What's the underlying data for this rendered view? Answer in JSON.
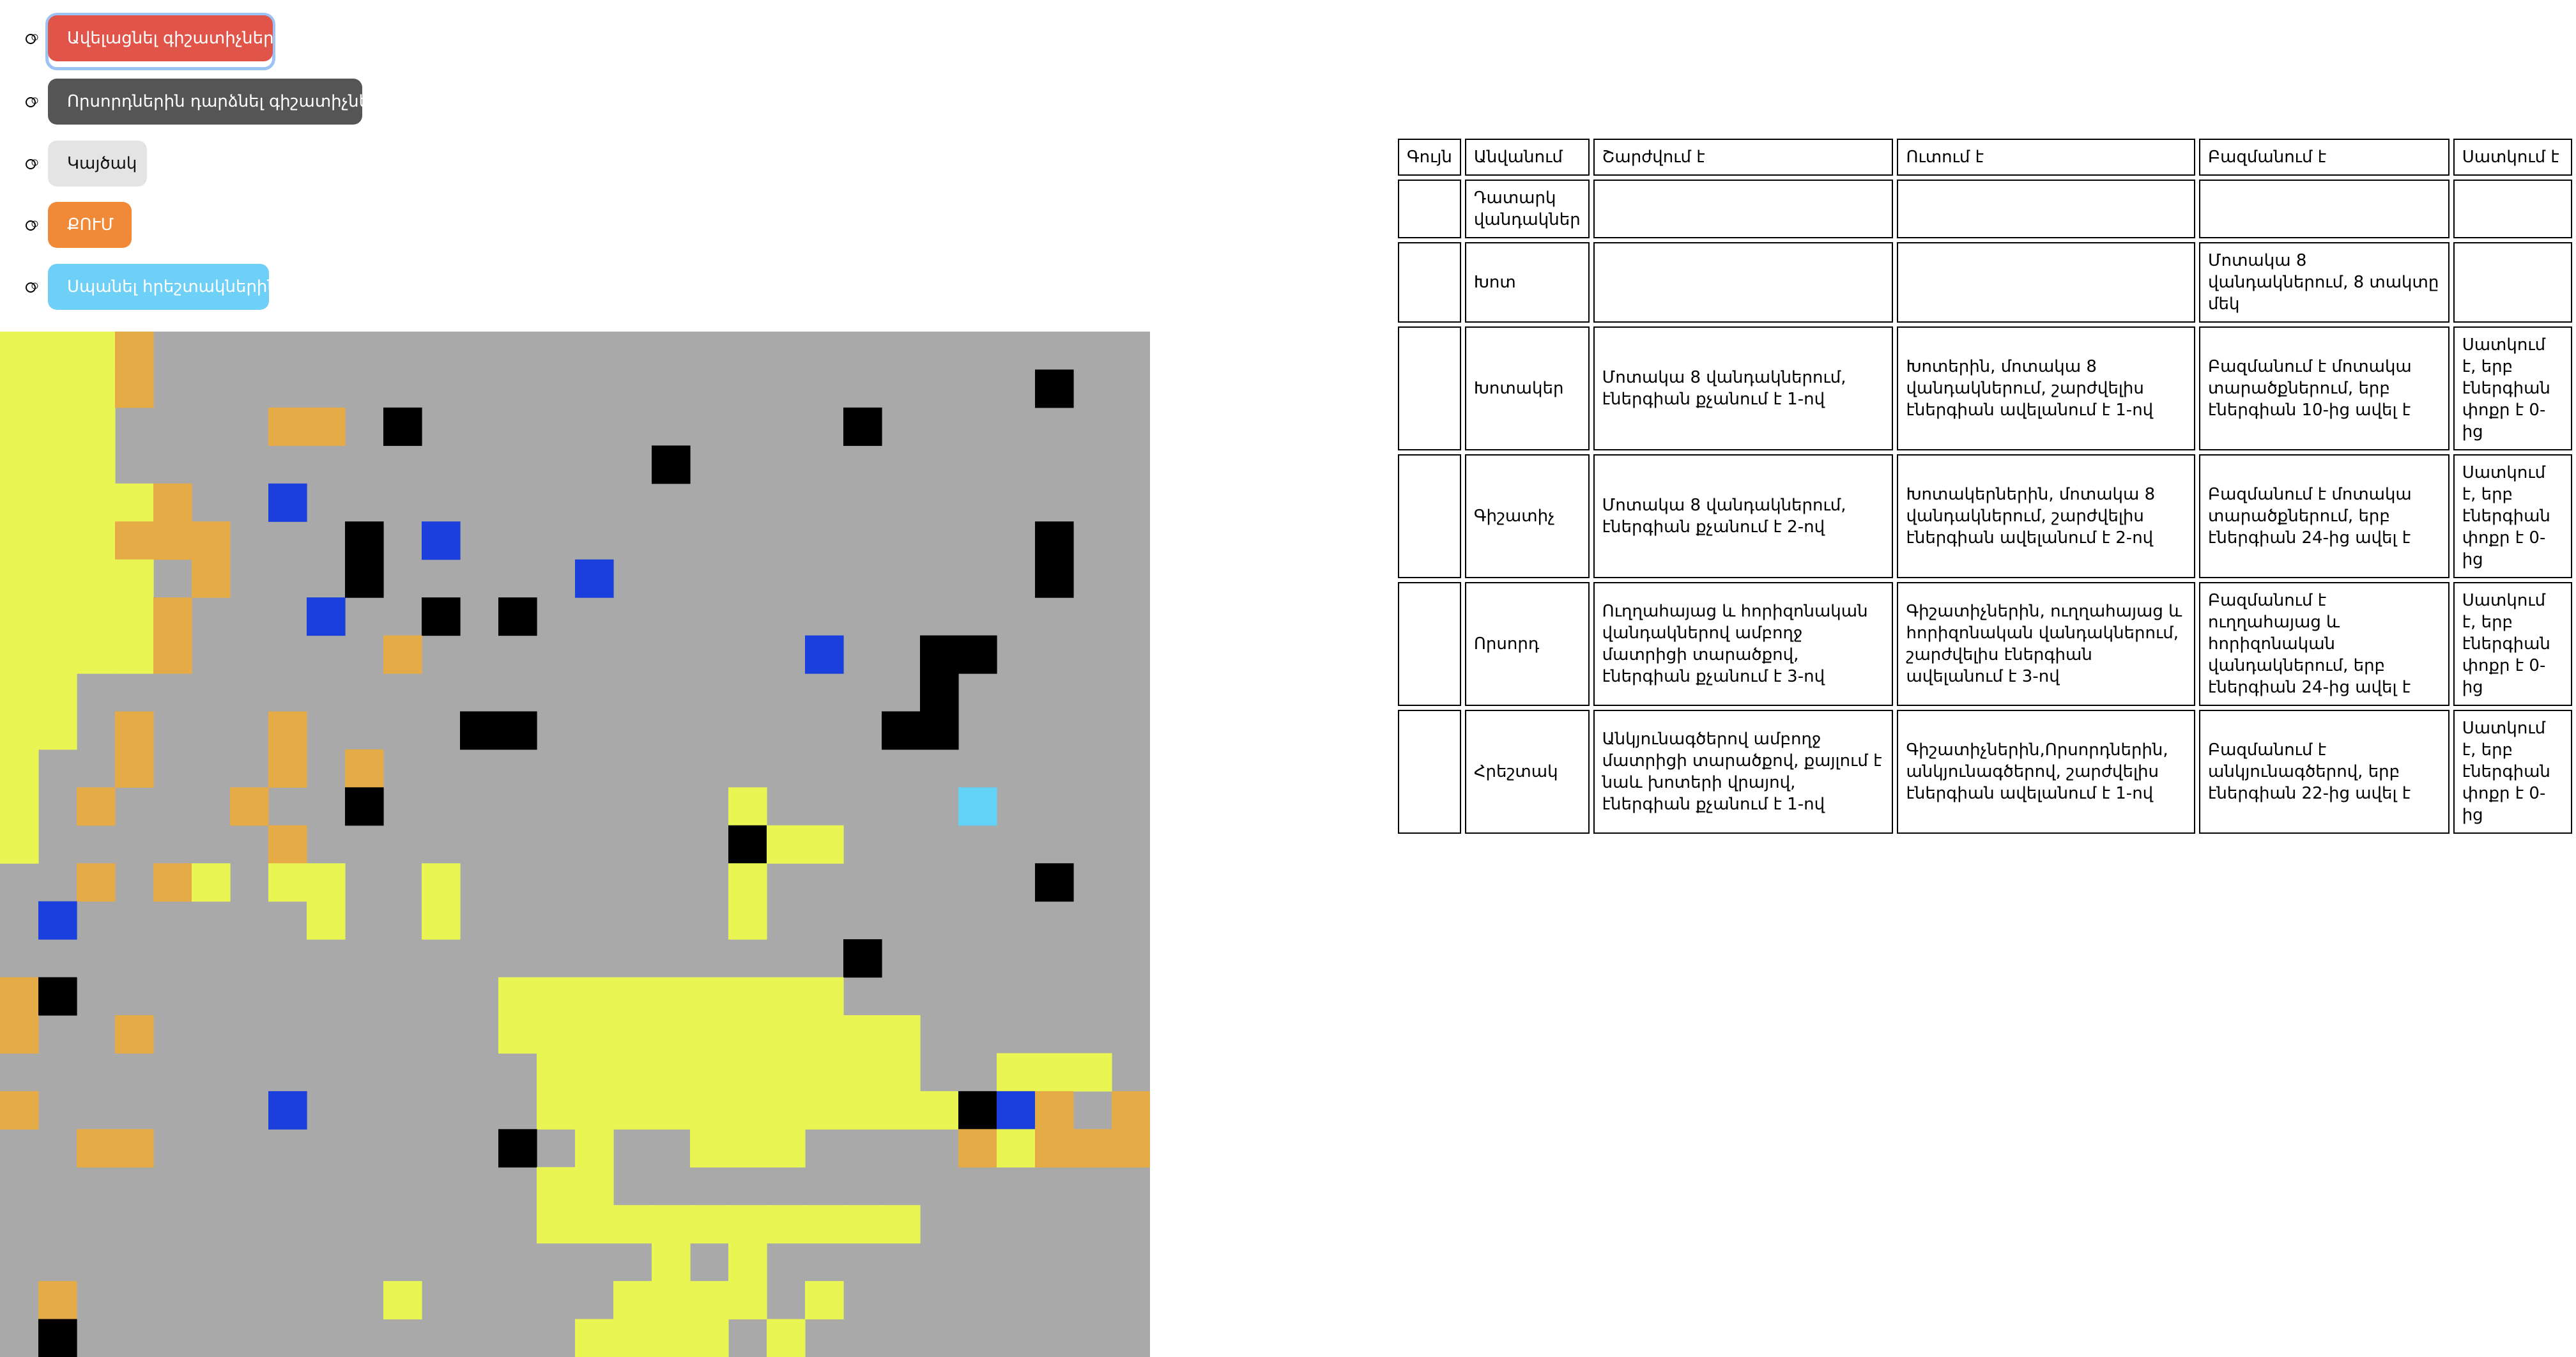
{
  "controls": {
    "buttons": [
      {
        "label": "Ավելացնել գիշատիչներ",
        "color": "#e0544a",
        "text_color": "#ffffff",
        "focused": true
      },
      {
        "label": "Որսորդներին դարձնել գիշատիչներ",
        "color": "#555555",
        "text_color": "#ffffff"
      },
      {
        "label": "Կայծակ",
        "color": "#e4e4e4",
        "text_color": "#111111"
      },
      {
        "label": "ՔՈՒՄ",
        "color": "#f08a38",
        "text_color": "#ffffff"
      },
      {
        "label": "Սպանել հրեշտակներին",
        "color": "#6fd0f7",
        "text_color": "#ffffff"
      }
    ]
  },
  "simulation_grid": {
    "columns": 30,
    "rows": 27,
    "colors": {
      "empty": "#a9a9a9",
      "grass": "#e8f553",
      "herbivore": "#e5ab47",
      "hunter": "#000000",
      "angel": "#62d2f6",
      "blue": "#1a3fdd"
    },
    "legend": {
      ".": "empty",
      "g": "grass",
      "h": "herbivore",
      "k": "hunter",
      "a": "angel",
      "b": "blue"
    },
    "cells": [
      "gggh..........................",
      "gggh.......................k..",
      "ggg....hh.k...........k.......",
      "ggg..............k............",
      "ggggh..b......................",
      "ggghhh...k.b...............k..",
      "gggg.h...k.....b...........k..",
      "ggggh...b..k.k................",
      "ggggh.....h..........b..kk....",
      "gg......................k.....",
      "gg.h...h....kk.........kk.....",
      "g..h...h.h.......................",
      "g.h...h..k.........g.....a....",
      "g......h...........kgg........",
      "..h.hg.gg..g.......g.......k..",
      ".b......g..g.......g...........",
      "......................k.......",
      "hk...........ggggggggg........",
      "h..h.........ggggggggggg......",
      "..............gggggggggg..ggg.",
      "h......b......gggggggggggkbh.h",
      "..hh.........k.g..ggg....hghhh",
      "..............gg..............",
      "..............gggggggggg......",
      ".................g.g..........",
      ".h........g.....gggg.g........",
      ".k.............gggg.g........."
    ]
  },
  "legend_table": {
    "headers": [
      "Գույն",
      "Անվանում",
      "Շարժվում է",
      "Ուտում է",
      "Բազմանում է",
      "Սատկում է"
    ],
    "rows": [
      {
        "color": "#808080",
        "name": "Դատարկ վանդակներ",
        "moves": "",
        "eats": "",
        "multiplies": "",
        "dies": ""
      },
      {
        "color": "#3a7b27",
        "name": "Խոտ",
        "moves": "",
        "eats": "",
        "multiplies": "Մոտակա 8 վանդակներում, 8 տակտը մեկ",
        "dies": ""
      },
      {
        "color": "#fafa4b",
        "name": "Խոտակեր",
        "moves": "Մոտակա 8 վանդակներում, էներգիան քչանում է 1-ով",
        "eats": "Խոտերին, մոտակա 8 վանդակներում, շարժվելիս էներգիան ավելանում է 1-ով",
        "multiplies": "Բազմանում է մոտակա տարածքներում, երբ էներգիան 10-ից ավել է",
        "dies": "Սատկում է, երբ էներգիան փոքր է 0-ից"
      },
      {
        "color": "#e83522",
        "name": "Գիշատիչ",
        "moves": "Մոտակա 8 վանդակներում, էներգիան քչանում է 2-ով",
        "eats": "Խոտակերներին, մոտակա 8 վանդակներում, շարժվելիս էներգիան ավելանում է 2-ով",
        "multiplies": "Բազմանում է մոտակա տարածքներում, երբ էներգիան 24-ից ավել է",
        "dies": "Սատկում է, երբ էներգիան փոքր է 0-ից"
      },
      {
        "color": "#000000",
        "name": "Որսորդ",
        "moves": "Ուղղահայաց և հորիզոնական վանդակներով ամբողջ մատրիցի տարածքով, էներգիան քչանում է 3-ով",
        "eats": "Գիշատիչներին, ուղղահայաց և հորիզոնական վանդակներում, շարժվելիս էներգիան ավելանում է 3-ով",
        "multiplies": "Բազմանում է ուղղահայաց և հորիզոնական վանդակներում, երբ էներգիան 24-ից ավել է",
        "dies": "Սատկում է, երբ էներգիան փոքր է 0-ից"
      },
      {
        "color": "#62d2f6",
        "name": "Հրեշտակ",
        "moves": "Անկյունագծերով ամբողջ մատրիցի տարածքով, քայլում է նաև խոտերի վրայով, էներգիան քչանում է 1-ով",
        "eats": "Գիշատիչներին,Որսորդներին, անկյունագծերով, շարժվելիս էներգիան ավելանում է 1-ով",
        "multiplies": "Բազմանում է անկյունագծերով, երբ էներգիան 22-ից ավել է",
        "dies": "Սատկում է, երբ էներգիան փոքր է 0-ից"
      }
    ]
  }
}
